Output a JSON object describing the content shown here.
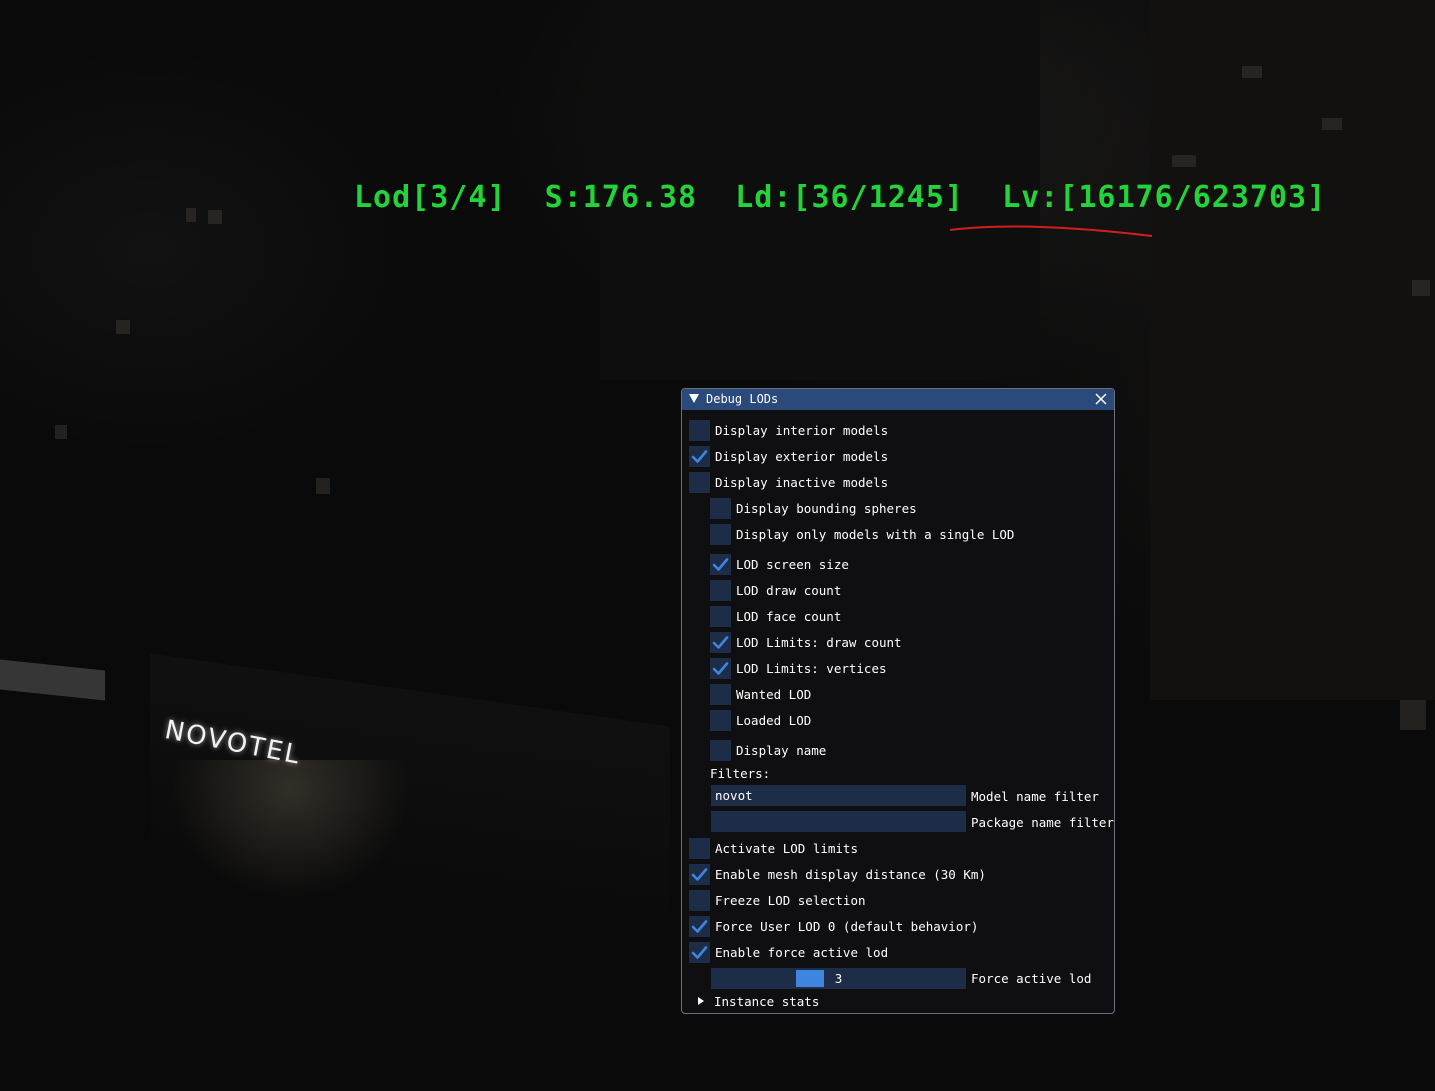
{
  "hud": {
    "text": "Lod[3/4]  S:176.38  Ld:[36/1245]  Lv:[16176/623703]",
    "color": "#22d43a",
    "annotation_color": "#d21e1e"
  },
  "scene": {
    "sign_text": "NOVOTEL"
  },
  "panel": {
    "title": "Debug LODs",
    "title_color": "#294a7a",
    "frame_color": "#1d2d47",
    "check_color": "#3d85e0",
    "checkboxes": [
      {
        "label": "Display interior models",
        "checked": false
      },
      {
        "label": "Display exterior models",
        "checked": true
      },
      {
        "label": "Display inactive models",
        "checked": false
      },
      {
        "label": "Display bounding spheres",
        "checked": false
      },
      {
        "label": "Display only models with a single LOD",
        "checked": false
      },
      {
        "label": "LOD screen size",
        "checked": true
      },
      {
        "label": "LOD draw count",
        "checked": false
      },
      {
        "label": "LOD face count",
        "checked": false
      },
      {
        "label": "LOD Limits: draw count",
        "checked": true
      },
      {
        "label": "LOD Limits: vertices",
        "checked": true
      },
      {
        "label": "Wanted LOD",
        "checked": false
      },
      {
        "label": "Loaded LOD",
        "checked": false
      },
      {
        "label": "Display name",
        "checked": false
      },
      {
        "label": "Activate LOD limits",
        "checked": false
      },
      {
        "label": "Enable mesh display distance (30 Km)",
        "checked": true
      },
      {
        "label": "Freeze LOD selection",
        "checked": false
      },
      {
        "label": "Force User LOD 0 (default behavior)",
        "checked": true
      },
      {
        "label": "Enable force active lod",
        "checked": true
      }
    ],
    "filters_label": "Filters:",
    "model_filter": {
      "value": "novot",
      "label": "Model name filter"
    },
    "package_filter": {
      "value": "",
      "label": "Package name filter"
    },
    "force_lod": {
      "value": "3",
      "label": "Force active lod",
      "fraction": 0.35
    },
    "instance_stats": "Instance stats"
  }
}
